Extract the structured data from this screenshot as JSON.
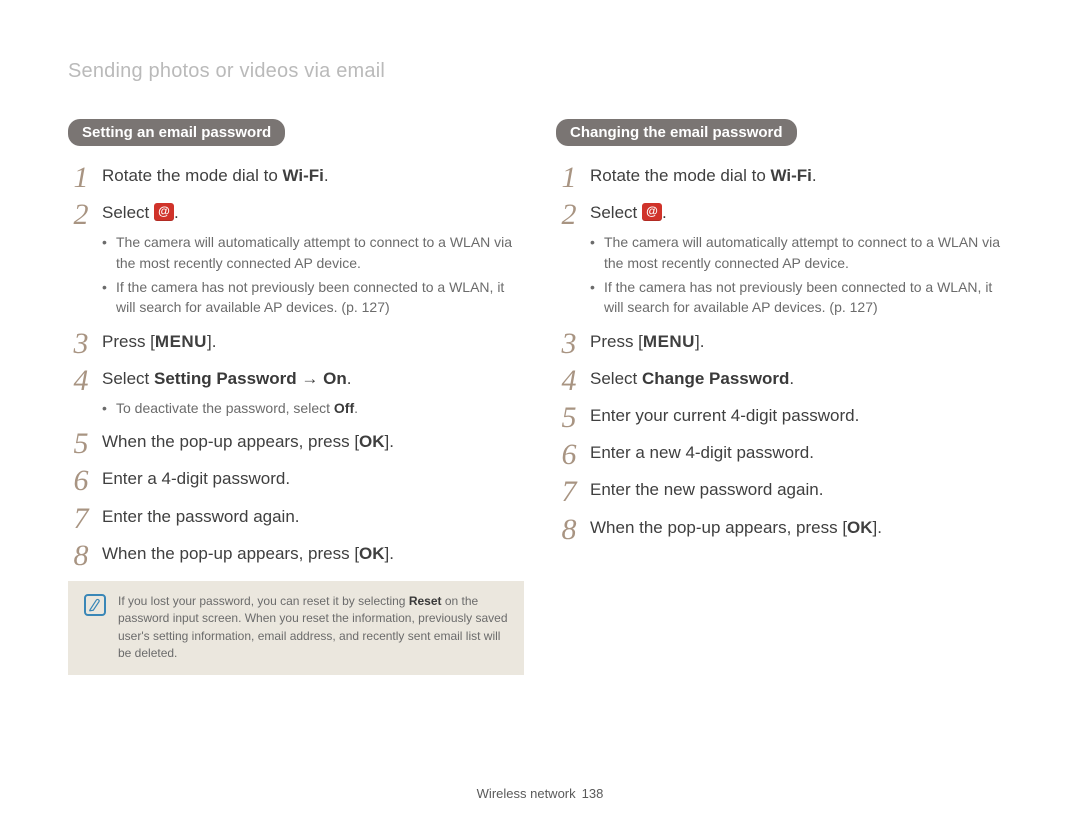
{
  "page": {
    "title": "Sending photos or videos via email",
    "footer_section": "Wireless network",
    "footer_page": "138"
  },
  "glyphs": {
    "wifi": "Wi-Fi",
    "menu": "MENU",
    "ok": "OK",
    "arrow": "→"
  },
  "left": {
    "pill": "Setting an email password",
    "s1_pre": "Rotate the mode dial to ",
    "s1_post": ".",
    "s2_pre": "Select ",
    "s2_post": ".",
    "s2_b1": "The camera will automatically attempt to connect to a WLAN via the most recently connected AP device.",
    "s2_b2": "If the camera has not previously been connected to a WLAN, it will search for available AP devices. (p. 127)",
    "s3_pre": "Press [",
    "s3_post": "].",
    "s4a": "Select ",
    "s4b": "Setting Password",
    "s4c": " ",
    "s4d": " ",
    "s4e": "On",
    "s4f": ".",
    "s4_b1a": "To deactivate the password, select ",
    "s4_b1b": "Off",
    "s4_b1c": ".",
    "s5_pre": "When the pop-up appears, press [",
    "s5_post": "].",
    "s6": "Enter a 4-digit password.",
    "s7": "Enter the password again.",
    "s8_pre": "When the pop-up appears, press [",
    "s8_post": "].",
    "note_a": "If you lost your password, you can reset it by selecting ",
    "note_b": "Reset",
    "note_c": " on the password input screen. When you reset the information, previously saved user's setting information, email address, and recently sent email list will be deleted."
  },
  "right": {
    "pill": "Changing the email password",
    "s1_pre": "Rotate the mode dial to ",
    "s1_post": ".",
    "s2_pre": "Select ",
    "s2_post": ".",
    "s2_b1": "The camera will automatically attempt to connect to a WLAN via the most recently connected AP device.",
    "s2_b2": "If the camera has not previously been connected to a WLAN, it will search for available AP devices. (p. 127)",
    "s3_pre": "Press [",
    "s3_post": "].",
    "s4a": "Select ",
    "s4b": "Change Password",
    "s4c": ".",
    "s5": "Enter your current 4-digit password.",
    "s6": "Enter a new 4-digit password.",
    "s7": "Enter the new password again.",
    "s8_pre": "When the pop-up appears, press [",
    "s8_post": "]."
  }
}
